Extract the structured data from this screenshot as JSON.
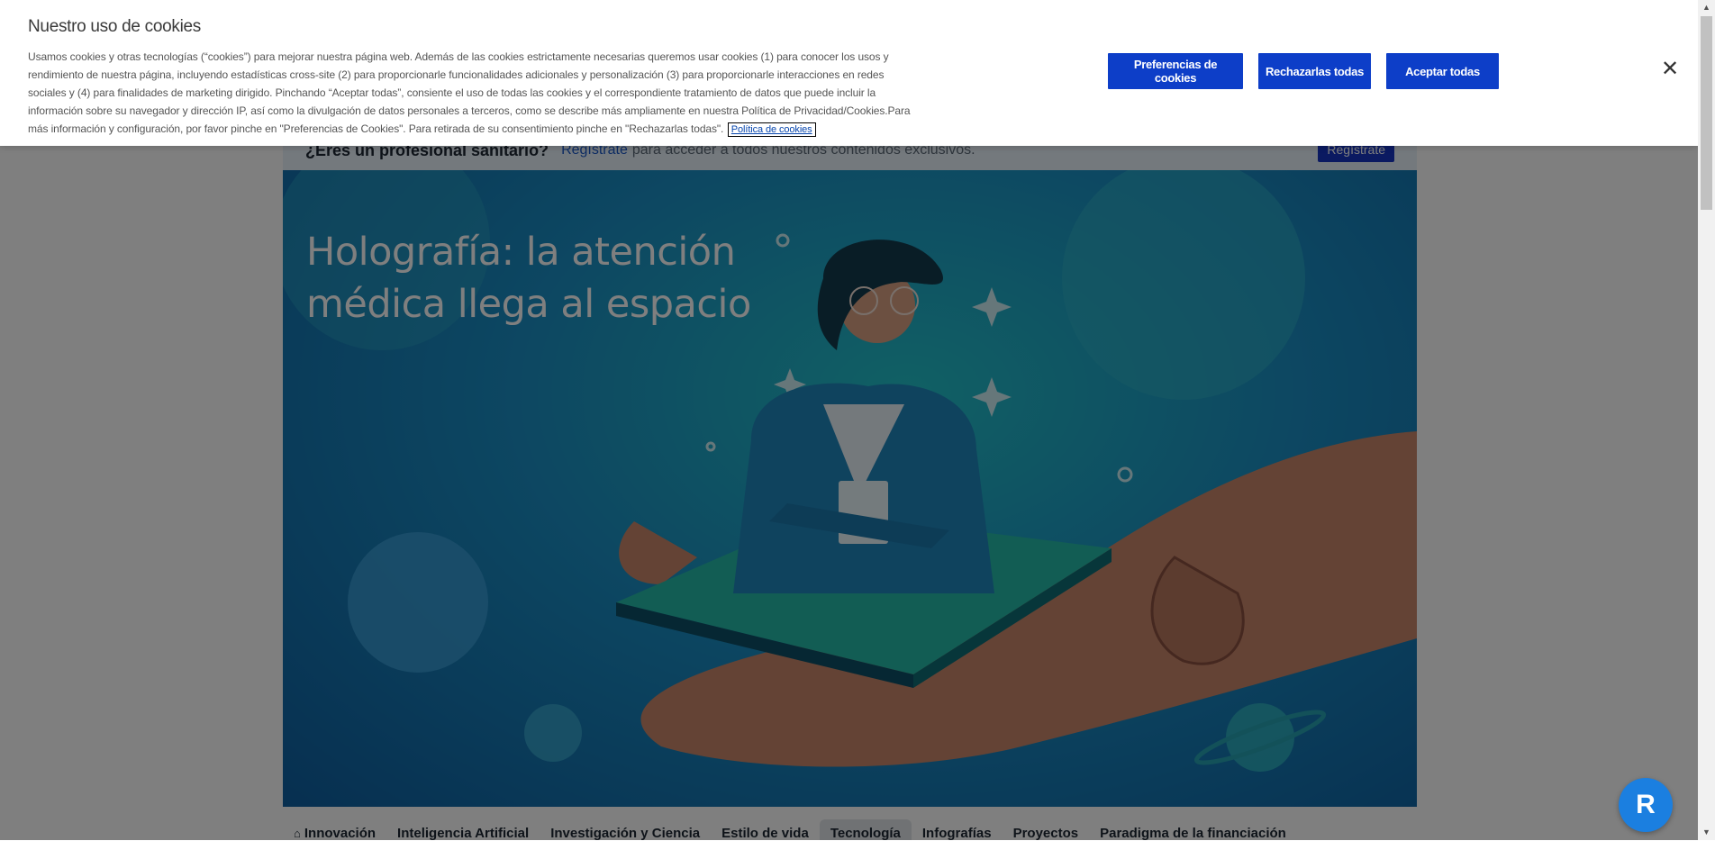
{
  "cookie_banner": {
    "title": "Nuestro uso de cookies",
    "description": "Usamos cookies y otras tecnologías (“cookies”) para mejorar nuestra página web. Además de las cookies estrictamente necesarias queremos usar cookies (1) para conocer los usos y rendimiento de nuestra página, incluyendo estadísticas cross-site (2) para proporcionarle funcionalidades adicionales y personalización (3) para proporcionarle interacciones en redes sociales y (4) para finalidades de marketing dirigido. Pinchando “Aceptar todas”, consiente el uso de todas las cookies y el correspondiente tratamiento de datos que puede incluir la información sobre su navegador y dirección IP, así como la divulgación de datos personales a terceros, como se describe más ampliamente en nuestra Política de Privacidad/Cookies.Para más información y configuración, por favor pinche en \"Preferencias de Cookies\". Para retirada de su consentimiento pinche en \"Rechazarlas todas\".",
    "policy_link": "Política de cookies",
    "buttons": {
      "preferences": "Preferencias de cookies",
      "reject_all": "Rechazarlas todas",
      "accept_all": "Aceptar todas"
    },
    "close_icon": "close-icon",
    "button_color": "#0d3ec8"
  },
  "pro_bar": {
    "question": "¿Eres un profesional sanitario?",
    "register_link": "Regístrate",
    "rest_text": "para acceder a todos nuestros contenidos exclusivos.",
    "register_button": "Regístrate"
  },
  "hero": {
    "title_line1": "Holografía: la atención",
    "title_line2": "médica llega al espacio"
  },
  "category_nav": {
    "items": [
      {
        "label": "Innovación",
        "icon": "home-icon"
      },
      {
        "label": "Inteligencia Artificial"
      },
      {
        "label": "Investigación y Ciencia"
      },
      {
        "label": "Estilo de vida"
      },
      {
        "label": "Tecnología",
        "active": true
      },
      {
        "label": "Infografías"
      },
      {
        "label": "Proyectos"
      },
      {
        "label": "Paradigma de la financiación"
      }
    ]
  },
  "floating_widget": {
    "icon": "reader-assistant-icon"
  }
}
